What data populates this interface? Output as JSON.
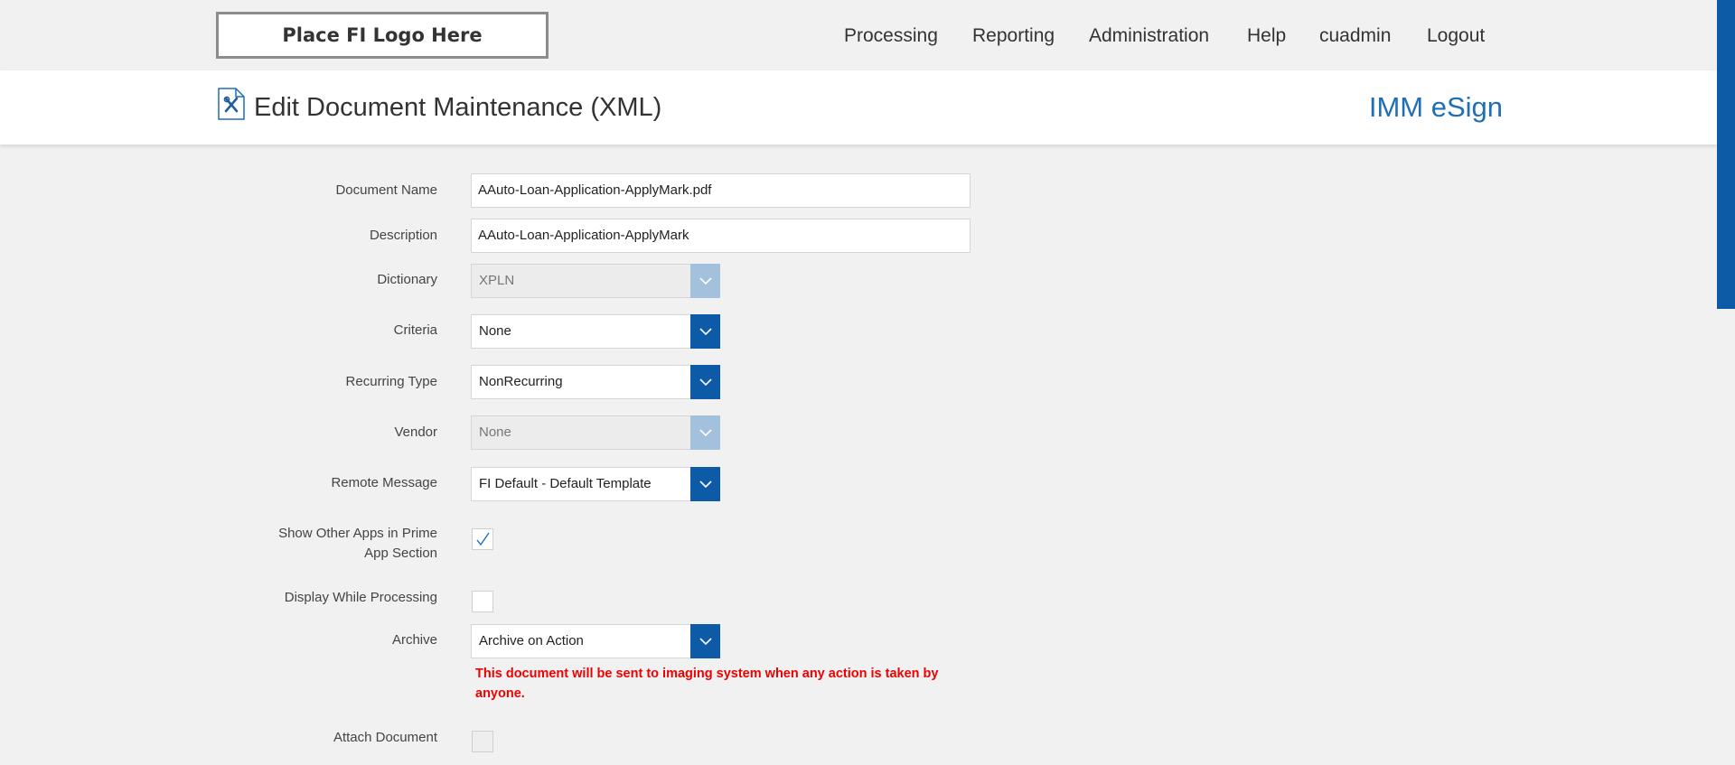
{
  "header": {
    "logo_text": "Place FI Logo Here",
    "nav": [
      "Processing",
      "Reporting",
      "Administration",
      "Help",
      "cuadmin",
      "Logout"
    ]
  },
  "titlebar": {
    "icon": "document-edit-icon",
    "title": "Edit Document Maintenance (XML)",
    "brand": "IMM eSign"
  },
  "form": {
    "document_name": {
      "label": "Document Name",
      "value": "AAuto-Loan-Application-ApplyMark.pdf"
    },
    "description": {
      "label": "Description",
      "value": "AAuto-Loan-Application-ApplyMark"
    },
    "dictionary": {
      "label": "Dictionary",
      "value": "XPLN",
      "disabled": true
    },
    "criteria": {
      "label": "Criteria",
      "value": "None"
    },
    "recurring_type": {
      "label": "Recurring Type",
      "value": "NonRecurring"
    },
    "vendor": {
      "label": "Vendor",
      "value": "None",
      "disabled": true
    },
    "remote_message": {
      "label": "Remote Message",
      "value": "FI Default - Default Template"
    },
    "show_other_apps": {
      "label": "Show Other Apps in Prime App Section",
      "checked": true
    },
    "display_while_processing": {
      "label": "Display While Processing",
      "checked": false
    },
    "archive": {
      "label": "Archive",
      "value": "Archive on Action",
      "warning": "This document will be sent to imaging system when any action is taken by anyone."
    },
    "attach_document": {
      "label": "Attach Document",
      "checked": false,
      "disabled": true
    }
  },
  "colors": {
    "accent": "#0d5aa7",
    "brand": "#1f6fb5",
    "warning": "#ee0000",
    "background": "#f1f1f1"
  }
}
